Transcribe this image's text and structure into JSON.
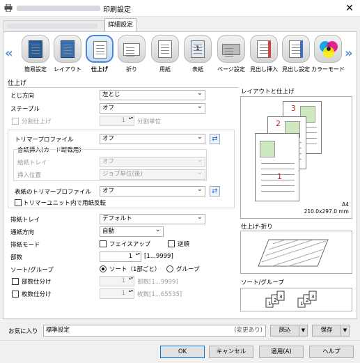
{
  "window": {
    "title": "印刷設定",
    "close_label": "✕"
  },
  "tabs": {
    "detail_label": "詳細設定"
  },
  "categories": [
    {
      "label": "簡易設定",
      "icon": "quick-settings-icon"
    },
    {
      "label": "レイアウト",
      "icon": "layout-icon"
    },
    {
      "label": "仕上げ",
      "icon": "finishing-icon",
      "selected": true
    },
    {
      "label": "折り",
      "icon": "fold-icon"
    },
    {
      "label": "用紙",
      "icon": "paper-icon"
    },
    {
      "label": "表紙",
      "icon": "cover-icon",
      "badge": "1"
    },
    {
      "label": "ページ設定",
      "icon": "page-settings-icon"
    },
    {
      "label": "見出し挿入",
      "icon": "tab-insert-icon"
    },
    {
      "label": "見出し設定",
      "icon": "tab-settings-icon"
    },
    {
      "label": "カラーモード",
      "icon": "color-mode-icon"
    }
  ],
  "nav": {
    "prev_arrow": "«",
    "next_arrow": "»"
  },
  "finishing": {
    "section_title": "仕上げ",
    "binding_label": "とじ方向",
    "binding_value": "左とじ",
    "staple_label": "ステープル",
    "staple_value": "オフ",
    "offset_label": "分割仕上げ",
    "offset_count": "1",
    "offset_unit": "分割単位",
    "trimmer_label": "トリマープロファイル",
    "trimmer_value": "オフ",
    "insert_group_label": "合紙挿入(カード断裁用)",
    "insert_tray_label": "給紙トレイ",
    "insert_tray_value": "オフ",
    "insert_position_label": "挿入位置",
    "insert_position_value": "ジョブ単位(後)",
    "cover_trimmer_label": "表紙のトリマープロファイル",
    "cover_trimmer_value": "オフ",
    "trimmer_reverse_label": "トリマーユニット内で用紙反転",
    "output_tray_label": "排紙トレイ",
    "output_tray_value": "デフォルト",
    "feed_direction_label": "通紙方向",
    "feed_direction_value": "自動",
    "output_mode_label": "排紙モード",
    "face_up_label": "フェイスアップ",
    "reverse_order_label": "逆順",
    "copies_label": "部数",
    "copies_value": "1",
    "copies_range": "[1...9999]",
    "sort_group_label": "ソート/グループ",
    "sort_label": "ソート（1部ごと）",
    "group_label": "グループ",
    "set_division_label": "部数仕分け",
    "set_division_value": "1",
    "set_division_range": "部数[1...9999]",
    "sheet_division_label": "枚数仕分け",
    "sheet_division_value": "1",
    "sheet_division_range": "枚数[1...65535]",
    "sync_icon": "sync-icon"
  },
  "preview": {
    "layout_title": "レイアウトと仕上げ",
    "page_numbers": [
      "3",
      "2",
      "1"
    ],
    "paper_size_name": "A4",
    "paper_size_dims": "210.0x297.0 mm",
    "fold_title": "仕上げ-折り",
    "sort_title": "ソート/グループ"
  },
  "favorites": {
    "label": "お気に入り",
    "value": "標準設定",
    "status": "(変更あり)",
    "load_label": "読込",
    "save_label": "保存"
  },
  "buttons": {
    "ok": "OK",
    "cancel": "キャンセル",
    "apply": "適用(A)",
    "help": "ヘルプ"
  },
  "colors": {
    "accent": "#4a86d6",
    "page_number": "#c8261c"
  }
}
